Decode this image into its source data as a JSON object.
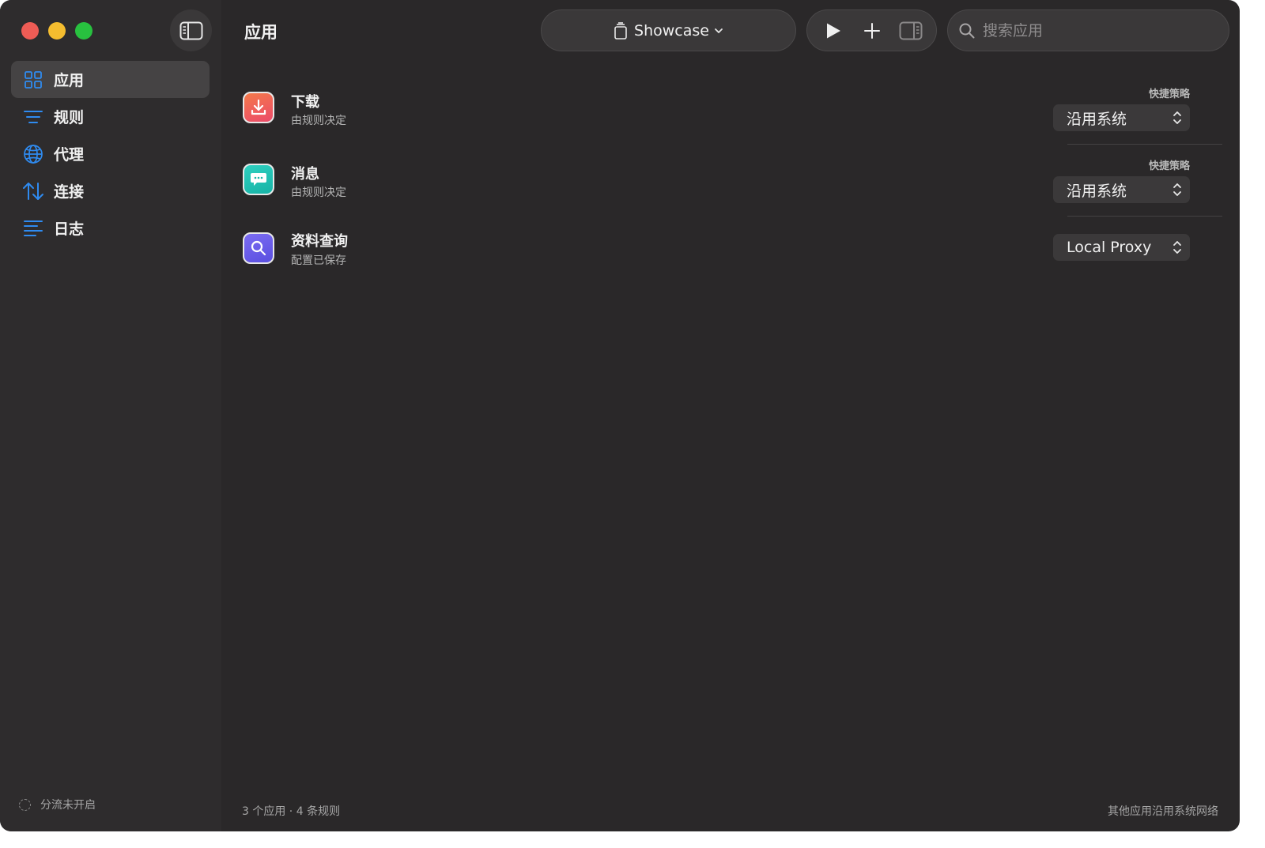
{
  "window": {
    "title": "应用"
  },
  "sidebar": {
    "items": [
      {
        "label": "应用",
        "icon": "grid-icon",
        "active": true
      },
      {
        "label": "规则",
        "icon": "rules-icon",
        "active": false
      },
      {
        "label": "代理",
        "icon": "globe-icon",
        "active": false
      },
      {
        "label": "连接",
        "icon": "arrows-updown-icon",
        "active": false
      },
      {
        "label": "日志",
        "icon": "log-icon",
        "active": false
      }
    ],
    "status": "分流未开启"
  },
  "toolbar": {
    "profile_label": "Showcase",
    "search_placeholder": "搜索应用"
  },
  "apps": [
    {
      "name": "下载",
      "subtitle": "由规则决定",
      "policy_label": "快捷策略",
      "policy": "沿用系统",
      "icon": "download-icon"
    },
    {
      "name": "消息",
      "subtitle": "由规则决定",
      "policy_label": "快捷策略",
      "policy": "沿用系统",
      "icon": "message-icon"
    },
    {
      "name": "资料查询",
      "subtitle": "配置已保存",
      "policy_label": "",
      "policy": "Local Proxy",
      "icon": "search-app-icon"
    }
  ],
  "footer": {
    "summary": "3 个应用 · 4 条规则",
    "note": "其他应用沿用系统网络"
  },
  "colors": {
    "accent": "#2f8bf0",
    "window_bg": "#2a2829",
    "sidebar_bg": "#2e2c2d"
  }
}
